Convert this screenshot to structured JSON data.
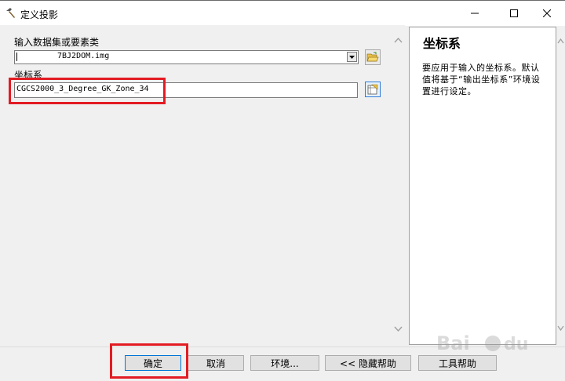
{
  "window": {
    "title": "定义投影"
  },
  "form": {
    "input_label": "输入数据集或要素类",
    "input_value": "7BJ2DOM.img",
    "coord_label": "坐标系",
    "coord_value": "CGCS2000_3_Degree_GK_Zone_34"
  },
  "help": {
    "title": "坐标系",
    "text": "要应用于输入的坐标系。默认值将基于“输出坐标系”环境设置进行设定。"
  },
  "buttons": {
    "ok": "确定",
    "cancel": "取消",
    "env": "环境...",
    "hide_help": "<< 隐藏帮助",
    "tool_help": "工具帮助"
  },
  "colors": {
    "highlight": "#e31b23",
    "focus": "#0078d7"
  }
}
